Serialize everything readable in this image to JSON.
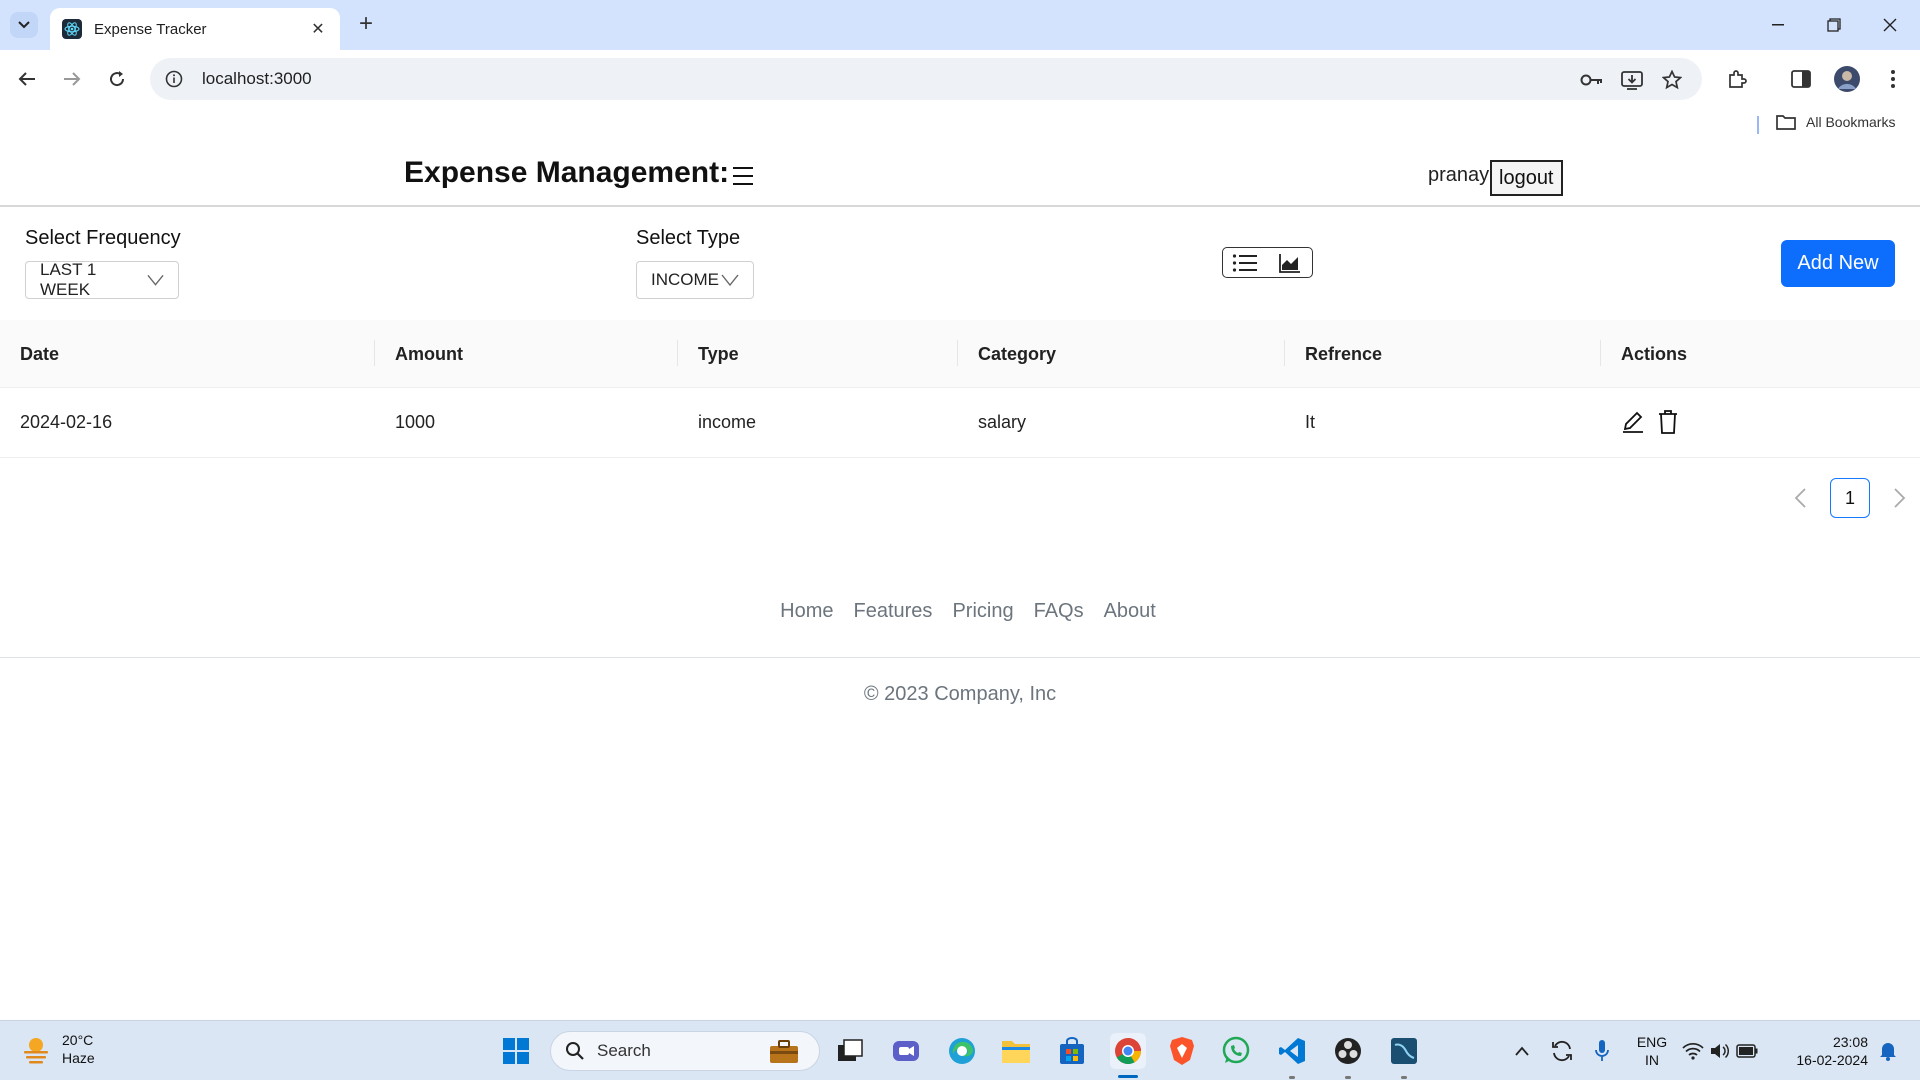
{
  "browser": {
    "tab_title": "Expense Tracker",
    "url": "localhost:3000",
    "bookmarks_label": "All Bookmarks"
  },
  "header": {
    "brand": "Expense Management",
    "username": "pranay",
    "logout_label": "logout"
  },
  "filters": {
    "frequency_label": "Select Frequency",
    "frequency_value": "LAST 1 WEEK",
    "type_label": "Select Type",
    "type_value": "INCOME",
    "add_new_label": "Add New"
  },
  "table": {
    "columns": [
      "Date",
      "Amount",
      "Type",
      "Category",
      "Refrence",
      "Actions"
    ],
    "rows": [
      {
        "date": "2024-02-16",
        "amount": "1000",
        "type": "income",
        "category": "salary",
        "reference": "It"
      }
    ]
  },
  "pagination": {
    "current_page": "1"
  },
  "footer": {
    "links": [
      "Home",
      "Features",
      "Pricing",
      "FAQs",
      "About"
    ],
    "copyright": "© 2023 Company, Inc"
  },
  "taskbar": {
    "temperature": "20°C",
    "weather": "Haze",
    "search_label": "Search",
    "language": "ENG",
    "region": "IN",
    "time": "23:08",
    "date": "16-02-2024"
  },
  "colors": {
    "primary": "#0d6efd",
    "tabbar": "#d3e3fd",
    "taskbar": "#dbe6f4",
    "muted_text": "#6c757d"
  }
}
